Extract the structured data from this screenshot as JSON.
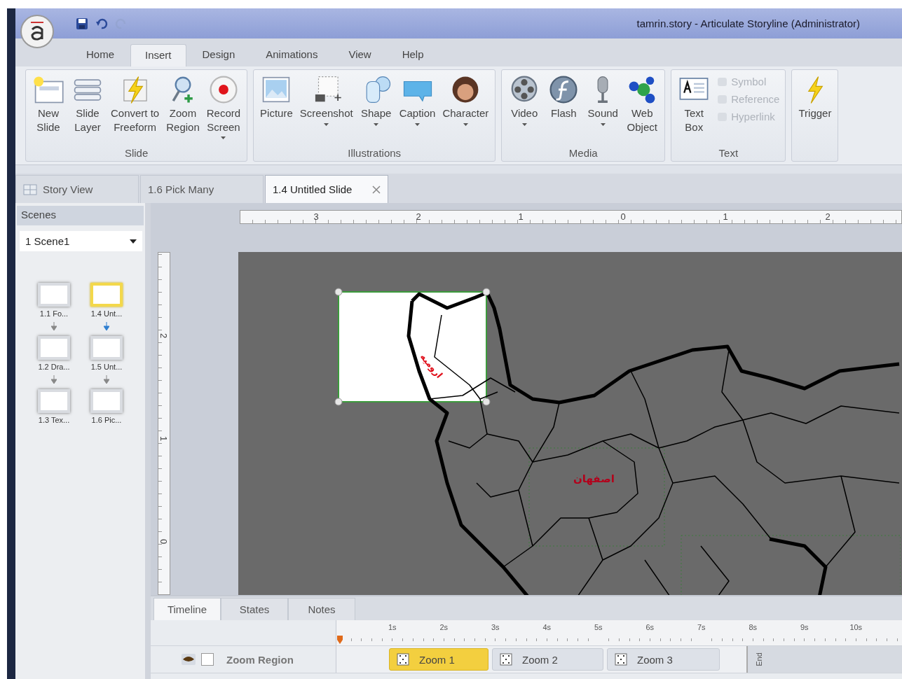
{
  "window": {
    "title": "tamrin.story -  Articulate Storyline (Administrator)"
  },
  "ribbon_tabs": [
    {
      "label": "Home",
      "selected": false
    },
    {
      "label": "Insert",
      "selected": true
    },
    {
      "label": "Design",
      "selected": false
    },
    {
      "label": "Animations",
      "selected": false
    },
    {
      "label": "View",
      "selected": false
    },
    {
      "label": "Help",
      "selected": false
    }
  ],
  "ribbon_groups": [
    {
      "label": "Slide",
      "buttons": [
        {
          "kind": "large",
          "label": "New\nSlide",
          "dropdown": false,
          "disabled": false
        },
        {
          "kind": "large",
          "label": "Slide\nLayer",
          "dropdown": false,
          "disabled": false
        },
        {
          "kind": "large",
          "label": "Convert to\nFreeform",
          "dropdown": false,
          "disabled": false
        },
        {
          "kind": "large",
          "label": "Zoom\nRegion",
          "dropdown": false,
          "disabled": false
        },
        {
          "kind": "large",
          "label": "Record\nScreen",
          "dropdown": true,
          "disabled": false
        }
      ]
    },
    {
      "label": "Illustrations",
      "buttons": [
        {
          "kind": "large",
          "label": "Picture",
          "dropdown": false,
          "disabled": false
        },
        {
          "kind": "large",
          "label": "Screenshot",
          "dropdown": true,
          "disabled": false
        },
        {
          "kind": "large",
          "label": "Shape",
          "dropdown": true,
          "disabled": false
        },
        {
          "kind": "large",
          "label": "Caption",
          "dropdown": true,
          "disabled": false
        },
        {
          "kind": "large",
          "label": "Character",
          "dropdown": true,
          "disabled": false
        }
      ]
    },
    {
      "label": "Media",
      "buttons": [
        {
          "kind": "large",
          "label": "Video",
          "dropdown": true,
          "disabled": false
        },
        {
          "kind": "large",
          "label": "Flash",
          "dropdown": false,
          "disabled": false
        },
        {
          "kind": "large",
          "label": "Sound",
          "dropdown": true,
          "disabled": false
        },
        {
          "kind": "large",
          "label": "Web\nObject",
          "dropdown": false,
          "disabled": false
        }
      ]
    },
    {
      "label": "Text",
      "buttons": [
        {
          "kind": "large",
          "label": "Text\nBox",
          "dropdown": false,
          "disabled": false
        },
        {
          "kind": "small",
          "label": "Symbol",
          "disabled": true
        },
        {
          "kind": "small",
          "label": "Reference",
          "disabled": true
        },
        {
          "kind": "small",
          "label": "Hyperlink",
          "disabled": true
        }
      ]
    },
    {
      "buttons": [
        {
          "kind": "large",
          "label": "Trigger",
          "dropdown": false,
          "disabled": false
        }
      ]
    }
  ],
  "doc_tabs": [
    {
      "label": "Story View",
      "selected": false,
      "closable": false
    },
    {
      "label": "1.6 Pick Many",
      "selected": false,
      "closable": false
    },
    {
      "label": "1.4 Untitled Slide",
      "selected": true,
      "closable": true
    }
  ],
  "scenes_panel": {
    "title": "Scenes",
    "scene": "1 Scene1",
    "slides": [
      {
        "label": "1.1 Fo...",
        "selected": false
      },
      {
        "label": "1.4 Unt...",
        "selected": true
      },
      {
        "label": "1.2 Dra...",
        "selected": false
      },
      {
        "label": "1.5 Unt...",
        "selected": false
      },
      {
        "label": "1.3 Tex...",
        "selected": false
      },
      {
        "label": "1.6 Pic...",
        "selected": false
      }
    ]
  },
  "horizontal_ruler": [
    "3",
    "2",
    "1",
    "0",
    "1",
    "2"
  ],
  "vertical_ruler": [
    "2",
    "1",
    "0"
  ],
  "slide": {
    "labels": [
      "ارومیه",
      "اصفهان"
    ]
  },
  "timeline": {
    "tabs": [
      {
        "label": "Timeline",
        "selected": true
      },
      {
        "label": "States",
        "selected": false
      },
      {
        "label": "Notes",
        "selected": false
      }
    ],
    "ticks": [
      "1s",
      "2s",
      "3s",
      "4s",
      "5s",
      "6s",
      "7s",
      "8s",
      "9s",
      "10s"
    ],
    "end_label": "End",
    "rows": [
      {
        "name": "Zoom Region",
        "visible": true,
        "locked": false,
        "segments": [
          {
            "label": "Zoom 1",
            "selected": true
          },
          {
            "label": "Zoom 2",
            "selected": false
          },
          {
            "label": "Zoom 3",
            "selected": false
          }
        ]
      }
    ]
  }
}
